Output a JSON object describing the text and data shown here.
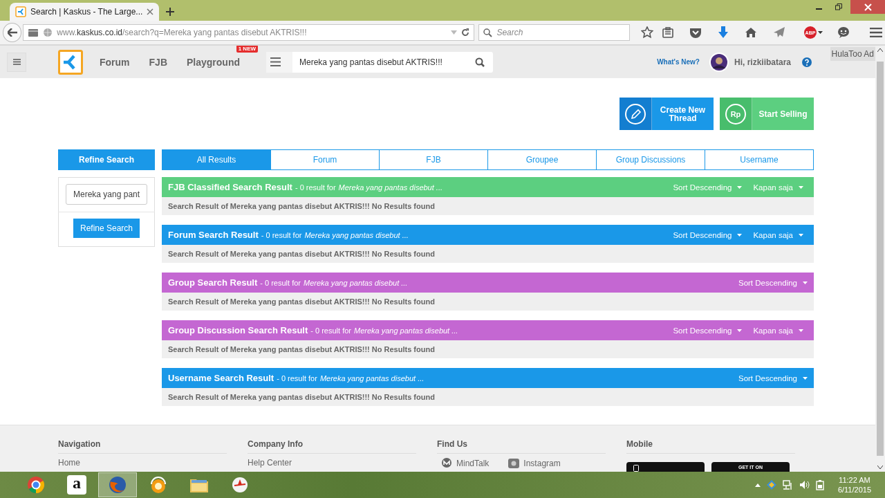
{
  "browser": {
    "tab_title": "Search | Kaskus - The Large...",
    "url": "www.**kaskus.co.id**/search?q=Mereka yang pantas disebut AKTRIS!!!",
    "search_placeholder": "Search",
    "adblock_label": "ABP"
  },
  "site_header": {
    "nav": [
      {
        "label": "Forum"
      },
      {
        "label": "FJB"
      },
      {
        "label": "Playground",
        "badge": "1 NEW"
      }
    ],
    "search_value": "Mereka yang pantas disebut AKTRIS!!!",
    "whats_new": "What's New?",
    "greeting": "Hi, rizkiibatara",
    "ad_label": "HulaToo Ad"
  },
  "actions": [
    {
      "kind": "thread",
      "label": "Create New Thread"
    },
    {
      "kind": "sell",
      "label": "Start Selling",
      "icon_text": "Rp"
    }
  ],
  "refine": {
    "title": "Refine Search",
    "value": "Mereka yang pant",
    "button": "Refine Search"
  },
  "tabs": [
    {
      "label": "All Results",
      "selected": true
    },
    {
      "label": "Forum",
      "selected": false
    },
    {
      "label": "FJB",
      "selected": false
    },
    {
      "label": "Groupee",
      "selected": false
    },
    {
      "label": "Group Discussions",
      "selected": false
    },
    {
      "label": "Username",
      "selected": false
    }
  ],
  "results": [
    {
      "title": "FJB Classified Search Result",
      "count": "- 0 result for",
      "query": "Mereka yang pantas disebut ...",
      "color": "#5ccf80",
      "sort": "Sort Descending",
      "time_filter": "Kapan saja",
      "message": "Search Result of Mereka yang pantas disebut AKTRIS!!! No Results found"
    },
    {
      "title": "Forum Search Result",
      "count": "- 0 result for",
      "query": "Mereka yang pantas disebut ...",
      "color": "#1a98e8",
      "sort": "Sort Descending",
      "time_filter": "Kapan saja",
      "message": "Search Result of Mereka yang pantas disebut AKTRIS!!! No Results found"
    },
    {
      "title": "Group Search Result",
      "count": "- 0 result for",
      "query": "Mereka yang pantas disebut ...",
      "color": "#c467d2",
      "sort": "Sort Descending",
      "message": "Search Result of Mereka yang pantas disebut AKTRIS!!! No Results found"
    },
    {
      "title": "Group Discussion Search Result",
      "count": "- 0 result for",
      "query": "Mereka yang pantas disebut ...",
      "color": "#c467d2",
      "sort": "Sort Descending",
      "time_filter": "Kapan saja",
      "message": "Search Result of Mereka yang pantas disebut AKTRIS!!! No Results found"
    },
    {
      "title": "Username Search Result",
      "count": "- 0 result for",
      "query": "Mereka yang pantas disebut ...",
      "color": "#1a98e8",
      "sort": "Sort Descending",
      "message": "Search Result of Mereka yang pantas disebut AKTRIS!!! No Results found"
    }
  ],
  "footer": {
    "columns": [
      {
        "kind": "links",
        "heading": "Navigation",
        "items": [
          "Home"
        ]
      },
      {
        "kind": "links",
        "heading": "Company Info",
        "items": [
          "Help Center"
        ]
      },
      {
        "kind": "social",
        "heading": "Find Us",
        "items": [
          "MindTalk",
          "Instagram"
        ]
      },
      {
        "kind": "stores",
        "heading": "Mobile",
        "badges": [
          {
            "kind": "phone"
          },
          {
            "kind": "play",
            "text": "GET IT ON"
          }
        ]
      }
    ]
  },
  "taskbar": {
    "apps": [
      {
        "kind": "ring",
        "selected": false
      },
      {
        "kind": "letter",
        "glyph": "a",
        "selected": false
      },
      {
        "kind": "fox",
        "selected": true
      },
      {
        "kind": "orb",
        "selected": false
      },
      {
        "kind": "folder",
        "selected": false
      },
      {
        "kind": "signal",
        "selected": false
      }
    ],
    "time": "11:22 AM",
    "date": "6/11/2015"
  }
}
